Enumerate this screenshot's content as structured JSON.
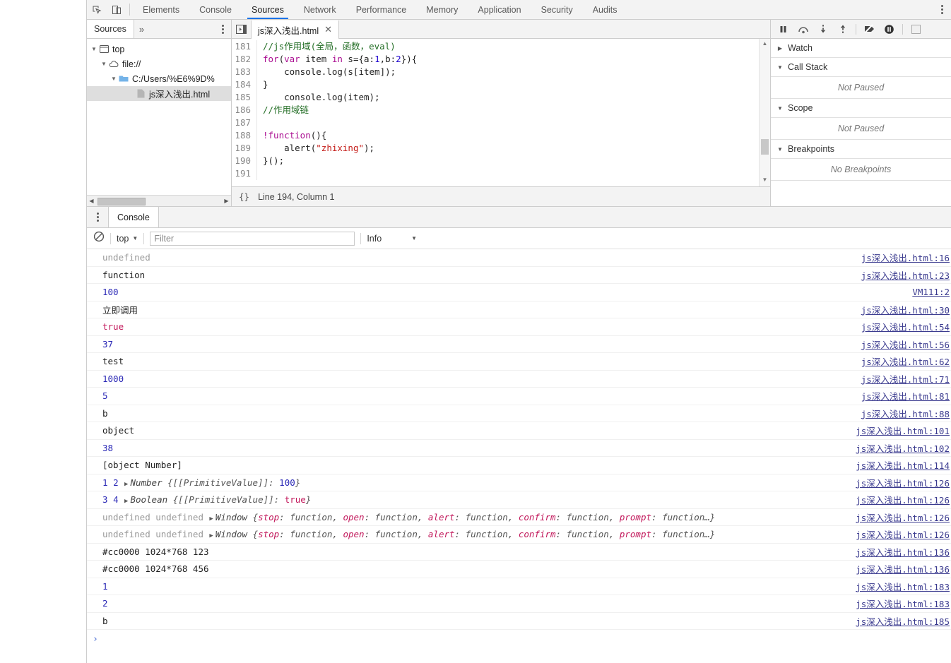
{
  "devtools": {
    "main_tabs": [
      {
        "label": "Elements",
        "active": false
      },
      {
        "label": "Console",
        "active": false
      },
      {
        "label": "Sources",
        "active": true
      },
      {
        "label": "Network",
        "active": false
      },
      {
        "label": "Performance",
        "active": false
      },
      {
        "label": "Memory",
        "active": false
      },
      {
        "label": "Application",
        "active": false
      },
      {
        "label": "Security",
        "active": false
      },
      {
        "label": "Audits",
        "active": false
      }
    ],
    "inspect_icon": "inspect-element-icon",
    "device_icon": "device-toolbar-icon",
    "menu_icon": "more-options-icon"
  },
  "navigator": {
    "tab_label": "Sources",
    "more_label": "»",
    "tree": [
      {
        "label": "top",
        "depth": 0,
        "icon": "frame-icon",
        "selected": false,
        "expanded": true
      },
      {
        "label": "file://",
        "depth": 1,
        "icon": "cloud-icon",
        "selected": false,
        "expanded": true
      },
      {
        "label": "C:/Users/%E6%9D%",
        "depth": 2,
        "icon": "folder-icon",
        "selected": false,
        "expanded": true
      },
      {
        "label": "js深入浅出.html",
        "depth": 3,
        "icon": "file-icon",
        "selected": true,
        "expanded": null
      }
    ]
  },
  "editor": {
    "tab_label": "js深入浅出.html",
    "close_label": "✕",
    "show_navigator_icon": "show-navigator-icon",
    "status": {
      "format_label": "{}",
      "position": "Line 194, Column 1"
    },
    "lines": [
      {
        "num": "181",
        "tokens": [
          {
            "t": "//js作用域(全局，函数，eval)",
            "c": "tok-com"
          }
        ]
      },
      {
        "num": "182",
        "tokens": [
          {
            "t": "for",
            "c": "tok-kw"
          },
          {
            "t": "(",
            "c": "tok-pl"
          },
          {
            "t": "var",
            "c": "tok-kw"
          },
          {
            "t": " item ",
            "c": "tok-pl"
          },
          {
            "t": "in",
            "c": "tok-kw"
          },
          {
            "t": " s={a:",
            "c": "tok-pl"
          },
          {
            "t": "1",
            "c": "tok-num"
          },
          {
            "t": ",b:",
            "c": "tok-pl"
          },
          {
            "t": "2",
            "c": "tok-num"
          },
          {
            "t": "}){",
            "c": "tok-pl"
          }
        ]
      },
      {
        "num": "183",
        "tokens": [
          {
            "t": "    console.log(s[item]);",
            "c": "tok-pl"
          }
        ]
      },
      {
        "num": "184",
        "tokens": [
          {
            "t": "}",
            "c": "tok-pl"
          }
        ]
      },
      {
        "num": "185",
        "tokens": [
          {
            "t": "    console.log(item);",
            "c": "tok-pl"
          }
        ]
      },
      {
        "num": "186",
        "tokens": [
          {
            "t": "//作用域链",
            "c": "tok-com"
          }
        ]
      },
      {
        "num": "187",
        "tokens": [
          {
            "t": "",
            "c": "tok-pl"
          }
        ]
      },
      {
        "num": "188",
        "tokens": [
          {
            "t": "!",
            "c": "tok-kw"
          },
          {
            "t": "function",
            "c": "tok-kw"
          },
          {
            "t": "(){",
            "c": "tok-pl"
          }
        ]
      },
      {
        "num": "189",
        "tokens": [
          {
            "t": "    alert(",
            "c": "tok-pl"
          },
          {
            "t": "\"zhixing\"",
            "c": "tok-str"
          },
          {
            "t": ");",
            "c": "tok-pl"
          }
        ]
      },
      {
        "num": "190",
        "tokens": [
          {
            "t": "}();",
            "c": "tok-pl"
          }
        ]
      },
      {
        "num": "191",
        "tokens": [
          {
            "t": "",
            "c": "tok-pl"
          }
        ]
      }
    ]
  },
  "debugger": {
    "toolbar_icons": [
      "pause-script-icon",
      "step-over-icon",
      "step-into-icon",
      "step-out-icon",
      "deactivate-breakpoints-icon",
      "pause-on-exceptions-icon",
      "checkbox-icon"
    ],
    "sections": [
      {
        "title": "Watch",
        "expanded": false,
        "body": null
      },
      {
        "title": "Call Stack",
        "expanded": true,
        "body": "Not Paused"
      },
      {
        "title": "Scope",
        "expanded": true,
        "body": "Not Paused"
      },
      {
        "title": "Breakpoints",
        "expanded": true,
        "body": "No Breakpoints"
      }
    ]
  },
  "drawer": {
    "tab_label": "Console",
    "toolbar": {
      "clear_icon": "clear-console-icon",
      "context": "top",
      "filter_placeholder": "Filter",
      "filter_value": "",
      "level": "Info"
    },
    "prompt_carat": "›",
    "rows": [
      {
        "cells": [
          {
            "t": "undefined",
            "c": "v-undef"
          }
        ],
        "link": "js深入浅出.html:16"
      },
      {
        "cells": [
          {
            "t": "function",
            "c": "v-plain"
          }
        ],
        "link": "js深入浅出.html:23"
      },
      {
        "cells": [
          {
            "t": "100",
            "c": "v-num"
          }
        ],
        "link": "VM111:2"
      },
      {
        "cells": [
          {
            "t": "立即调用",
            "c": "v-cjk"
          }
        ],
        "link": "js深入浅出.html:30"
      },
      {
        "cells": [
          {
            "t": "true",
            "c": "v-bool"
          }
        ],
        "link": "js深入浅出.html:54"
      },
      {
        "cells": [
          {
            "t": "37",
            "c": "v-num"
          }
        ],
        "link": "js深入浅出.html:56"
      },
      {
        "cells": [
          {
            "t": "test",
            "c": "v-plain"
          }
        ],
        "link": "js深入浅出.html:62"
      },
      {
        "cells": [
          {
            "t": "1000",
            "c": "v-num"
          }
        ],
        "link": "js深入浅出.html:71"
      },
      {
        "cells": [
          {
            "t": "5",
            "c": "v-num"
          }
        ],
        "link": "js深入浅出.html:81"
      },
      {
        "cells": [
          {
            "t": "b",
            "c": "v-plain"
          }
        ],
        "link": "js深入浅出.html:88"
      },
      {
        "cells": [
          {
            "t": "object",
            "c": "v-plain"
          }
        ],
        "link": "js深入浅出.html:101"
      },
      {
        "cells": [
          {
            "t": "38",
            "c": "v-num"
          }
        ],
        "link": "js深入浅出.html:102"
      },
      {
        "cells": [
          {
            "t": "[object Number]",
            "c": "v-plain"
          }
        ],
        "link": "js深入浅出.html:114"
      },
      {
        "cells": [
          {
            "t": "1",
            "c": "v-idx"
          },
          {
            "t": " ",
            "c": "v-plain"
          },
          {
            "t": "2",
            "c": "v-idx"
          },
          {
            "t": " ▶",
            "c": "disc"
          },
          {
            "t": "Number ",
            "c": "v-objname"
          },
          {
            "t": "{[[PrimitiveValue]]: ",
            "c": "v-objbody"
          },
          {
            "t": "100",
            "c": "v-num"
          },
          {
            "t": "}",
            "c": "v-objbody"
          }
        ],
        "link": "js深入浅出.html:126"
      },
      {
        "cells": [
          {
            "t": "3",
            "c": "v-idx"
          },
          {
            "t": " ",
            "c": "v-plain"
          },
          {
            "t": "4",
            "c": "v-idx"
          },
          {
            "t": " ▶",
            "c": "disc"
          },
          {
            "t": "Boolean ",
            "c": "v-objname"
          },
          {
            "t": "{[[PrimitiveValue]]: ",
            "c": "v-objbody"
          },
          {
            "t": "true",
            "c": "v-bool"
          },
          {
            "t": "}",
            "c": "v-objbody"
          }
        ],
        "link": "js深入浅出.html:126"
      },
      {
        "cells": [
          {
            "t": "undefined undefined",
            "c": "v-undef"
          },
          {
            "t": " ▶",
            "c": "disc"
          },
          {
            "t": "Window ",
            "c": "v-objname"
          },
          {
            "t": "{",
            "c": "v-objbody"
          },
          {
            "t": "stop",
            "c": "v-key"
          },
          {
            "t": ": function, ",
            "c": "v-objbody"
          },
          {
            "t": "open",
            "c": "v-key"
          },
          {
            "t": ": function, ",
            "c": "v-objbody"
          },
          {
            "t": "alert",
            "c": "v-key"
          },
          {
            "t": ": function, ",
            "c": "v-objbody"
          },
          {
            "t": "confirm",
            "c": "v-key"
          },
          {
            "t": ": function, ",
            "c": "v-objbody"
          },
          {
            "t": "prompt",
            "c": "v-key"
          },
          {
            "t": ": function…}",
            "c": "v-objbody"
          }
        ],
        "link": "js深入浅出.html:126"
      },
      {
        "cells": [
          {
            "t": "undefined undefined",
            "c": "v-undef"
          },
          {
            "t": " ▶",
            "c": "disc"
          },
          {
            "t": "Window ",
            "c": "v-objname"
          },
          {
            "t": "{",
            "c": "v-objbody"
          },
          {
            "t": "stop",
            "c": "v-key"
          },
          {
            "t": ": function, ",
            "c": "v-objbody"
          },
          {
            "t": "open",
            "c": "v-key"
          },
          {
            "t": ": function, ",
            "c": "v-objbody"
          },
          {
            "t": "alert",
            "c": "v-key"
          },
          {
            "t": ": function, ",
            "c": "v-objbody"
          },
          {
            "t": "confirm",
            "c": "v-key"
          },
          {
            "t": ": function, ",
            "c": "v-objbody"
          },
          {
            "t": "prompt",
            "c": "v-key"
          },
          {
            "t": ": function…}",
            "c": "v-objbody"
          }
        ],
        "link": "js深入浅出.html:126"
      },
      {
        "cells": [
          {
            "t": "#cc0000 1024*768 123",
            "c": "v-plain"
          }
        ],
        "link": "js深入浅出.html:136"
      },
      {
        "cells": [
          {
            "t": "#cc0000 1024*768 456",
            "c": "v-plain"
          }
        ],
        "link": "js深入浅出.html:136"
      },
      {
        "cells": [
          {
            "t": "1",
            "c": "v-num"
          }
        ],
        "link": "js深入浅出.html:183"
      },
      {
        "cells": [
          {
            "t": "2",
            "c": "v-num"
          }
        ],
        "link": "js深入浅出.html:183"
      },
      {
        "cells": [
          {
            "t": "b",
            "c": "v-plain"
          }
        ],
        "link": "js深入浅出.html:185"
      }
    ]
  },
  "colors": {
    "accent": "#1a73e8",
    "toolbar_bg": "#f3f3f3",
    "border": "#cdcdcd",
    "link": "#3b3b8f"
  }
}
